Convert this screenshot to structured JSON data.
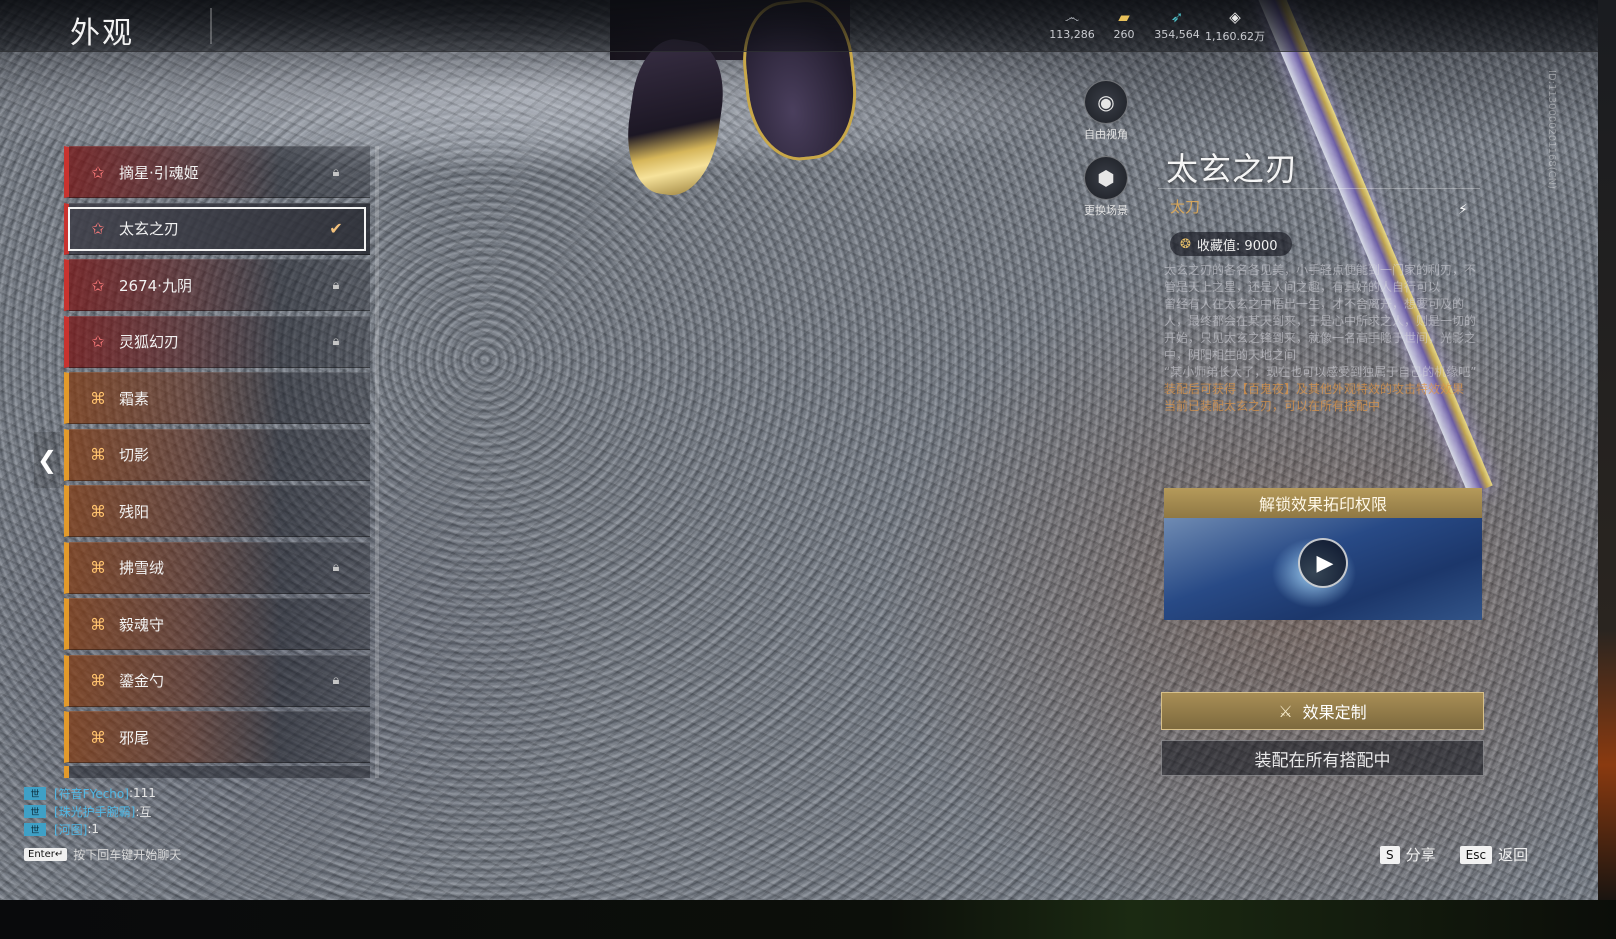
{
  "header": {
    "title": "外观"
  },
  "currencies": [
    {
      "icon": "swirl-icon",
      "glyph": "෴",
      "value": "113,286",
      "color": "#cfd3da"
    },
    {
      "icon": "ticket-icon",
      "glyph": "▰",
      "value": "260",
      "color": "#e8c15a"
    },
    {
      "icon": "feather-icon",
      "glyph": "➶",
      "value": "354,564",
      "color": "#4fc0c8"
    },
    {
      "icon": "diamond-icon",
      "glyph": "◈",
      "value": "1,160.62万",
      "color": "#e8e8e8"
    }
  ],
  "side_tools": {
    "free_view": {
      "label": "自由视角",
      "icon": "camera-icon"
    },
    "change_scene": {
      "label": "更换场景",
      "icon": "cube-icon"
    }
  },
  "items": [
    {
      "name": "摘星·引魂姬",
      "grade": "red",
      "state": "locked"
    },
    {
      "name": "太玄之刃",
      "grade": "red",
      "state": "equipped",
      "selected": true
    },
    {
      "name": "2674·九阴",
      "grade": "red",
      "state": "locked"
    },
    {
      "name": "灵狐幻刃",
      "grade": "red",
      "state": "locked"
    },
    {
      "name": "霜素",
      "grade": "orange",
      "state": ""
    },
    {
      "name": "切影",
      "grade": "orange",
      "state": ""
    },
    {
      "name": "残阳",
      "grade": "orange",
      "state": ""
    },
    {
      "name": "拂雪绒",
      "grade": "orange",
      "state": "locked"
    },
    {
      "name": "毅魂守",
      "grade": "orange",
      "state": ""
    },
    {
      "name": "鎏金勺",
      "grade": "orange",
      "state": "locked"
    },
    {
      "name": "邪尾",
      "grade": "orange",
      "state": ""
    }
  ],
  "detail": {
    "name": "太玄之刃",
    "type": "太刀",
    "collect_label": "收藏值: 9000",
    "description": [
      "太玄之刃的各名各见美，小手轻点便能到一门家的利刃，不管是天上之星，还是人间之趣，有真好的人自行可以",
      "曾经有人在太玄之中悟出一生，才不舍离开，想要可及的人，最终都会在某天到来，于是心中所求之人，则是一切的开始，只见太玄之锋到来，就像一名高手隐于世间，光影之中，阴阳相生的天地之间",
      "“某小师弟长大了，现在也可以感受到独属于自己的机缘吧”"
    ],
    "effects": [
      "装配后可获得【百鬼夜】及其他外观特效的攻击特效效果",
      "当前已装配太玄之刃，可以在所有搭配中"
    ],
    "unlock_title": "解锁效果拓印权限",
    "custom_label": "效果定制",
    "equip_status": "装配在所有搭配中"
  },
  "version": "ID:1130000201168(CN)",
  "chat": {
    "lines": [
      {
        "channel": "世",
        "link": "[符音FYecho]",
        "text": ":111"
      },
      {
        "channel": "世",
        "link": "[珠光护手腕霸]",
        "text": ":互"
      },
      {
        "channel": "世",
        "link": "[河图]",
        "text": ":1"
      }
    ],
    "hint_key": "Enter↵",
    "hint_text": "按下回车键开始聊天"
  },
  "hotkeys": [
    {
      "key": "S",
      "label": "分享"
    },
    {
      "key": "Esc",
      "label": "返回"
    }
  ]
}
